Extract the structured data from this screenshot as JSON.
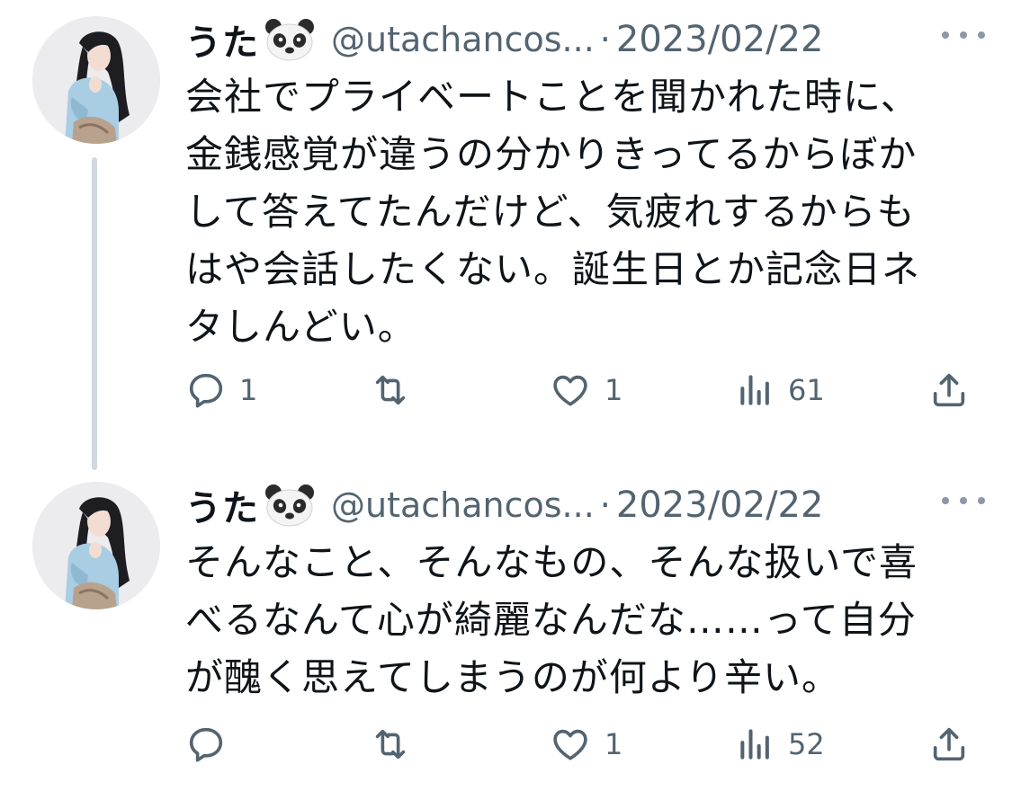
{
  "thread": {
    "tweets": [
      {
        "display_name": "うた",
        "handle": "@utachancos...",
        "separator": "·",
        "date": "2023/02/22",
        "text": "会社でプライベートことを聞かれた時に、金銭感覚が違うの分かりきってるからぼかして答えてたんだけど、気疲れするからもはや会話したくない。誕生日とか記念日ネタしんどい。",
        "lines": [
          "会社でプライベートことを聞かれた時に、",
          "金銭感覚が違うの分かりきってるからぼか",
          "して答えてたんだけど、気疲れするからも",
          "はや会話したくない。誕生日とか記念日ネ",
          "タしんどい。"
        ],
        "replies": "1",
        "retweets": "",
        "likes": "1",
        "views": "61"
      },
      {
        "display_name": "うた",
        "handle": "@utachancos...",
        "separator": "·",
        "date": "2023/02/22",
        "text": "そんなこと、そんなもの、そんな扱いで喜べるなんて心が綺麗なんだな……って自分が醜く思えてしまうのが何より辛い。",
        "lines": [
          "そんなこと、そんなもの、そんな扱いで喜",
          "べるなんて心が綺麗なんだな……って自分",
          "が醜く思えてしまうのが何より辛い。"
        ],
        "replies": "",
        "retweets": "",
        "likes": "1",
        "views": "52"
      }
    ]
  },
  "icons": {
    "avatar": "avatar",
    "name_emoji": "panda-face-icon",
    "more": "more-icon",
    "reply": "reply-icon",
    "retweet": "retweet-icon",
    "like": "heart-icon",
    "views": "views-icon",
    "share": "share-icon"
  },
  "colors": {
    "text": "#0f1419",
    "secondary": "#536471",
    "thread_line": "#cfd9de",
    "background": "#ffffff"
  }
}
